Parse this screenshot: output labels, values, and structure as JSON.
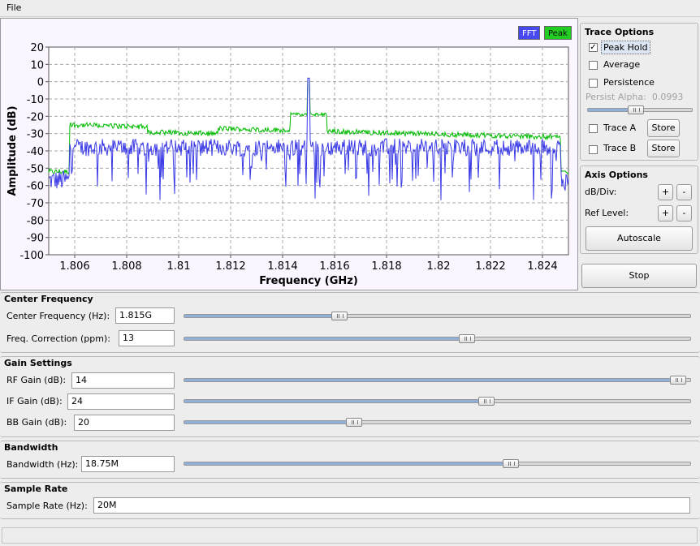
{
  "menu": {
    "file": "File"
  },
  "plot": {
    "legend": [
      {
        "label": "FFT",
        "color": "#4040e0"
      },
      {
        "label": "Peak",
        "color": "#00bb00"
      }
    ],
    "xlabel": "Frequency (GHz)",
    "ylabel": "Amplitude (dB)",
    "x_ticks": [
      "1.806",
      "1.808",
      "1.81",
      "1.812",
      "1.814",
      "1.816",
      "1.818",
      "1.82",
      "1.822",
      "1.824"
    ],
    "y_ticks": [
      "20",
      "10",
      "0",
      "-10",
      "-20",
      "-30",
      "-40",
      "-50",
      "-60",
      "-70",
      "-80",
      "-90",
      "-100"
    ]
  },
  "chart_data": {
    "type": "line",
    "xlabel": "Frequency (GHz)",
    "ylabel": "Amplitude (dB)",
    "xlim": [
      1.805,
      1.825
    ],
    "ylim": [
      -100,
      20
    ],
    "grid": true,
    "legend_position": "top-right",
    "series": [
      {
        "name": "FFT",
        "color": "#4040e0",
        "shape": {
          "noise_floor": -57,
          "band_start": 1.806,
          "band_end": 1.8245,
          "band_level": -40,
          "spike_x": 1.815,
          "spike_y": 2
        }
      },
      {
        "name": "Peak",
        "color": "#00bb00",
        "shape": {
          "noise_floor": -52,
          "band_start": 1.806,
          "band_end": 1.8245,
          "band_level_left": -25,
          "band_level_right": -32,
          "bump_x": 1.815,
          "bump_y": -19
        }
      }
    ]
  },
  "trace_options": {
    "title": "Trace Options",
    "peak_hold": {
      "label": "Peak Hold",
      "checked": true
    },
    "average": {
      "label": "Average",
      "checked": false
    },
    "persistence": {
      "label": "Persistence",
      "checked": false
    },
    "persist_alpha": {
      "label": "Persist Alpha:",
      "value": "0.0993",
      "level": 0.45
    },
    "trace_a": {
      "label": "Trace A",
      "checked": false,
      "store": "Store"
    },
    "trace_b": {
      "label": "Trace B",
      "checked": false,
      "store": "Store"
    }
  },
  "axis_options": {
    "title": "Axis Options",
    "db_div": "dB/Div:",
    "ref_level": "Ref Level:",
    "plus": "+",
    "minus": "-",
    "autoscale": "Autoscale"
  },
  "stop_button": "Stop",
  "center_frequency": {
    "title": "Center Frequency",
    "freq_label": "Center Frequency (Hz):",
    "freq_value": "1.815G",
    "freq_level": 0.3,
    "corr_label": "Freq. Correction (ppm):",
    "corr_value": "13",
    "corr_level": 0.56
  },
  "gain": {
    "title": "Gain Settings",
    "rf_label": "RF Gain (dB):",
    "rf_value": "14",
    "rf_level": 0.99,
    "if_label": "IF Gain (dB):",
    "if_value": "24",
    "if_level": 0.6,
    "bb_label": "BB Gain (dB):",
    "bb_value": "20",
    "bb_level": 0.33
  },
  "bandwidth": {
    "title": "Bandwidth",
    "label": "Bandwidth (Hz):",
    "value": "18.75M",
    "level": 0.65
  },
  "sample_rate": {
    "title": "Sample Rate",
    "label": "Sample Rate (Hz):",
    "value": "20M"
  }
}
